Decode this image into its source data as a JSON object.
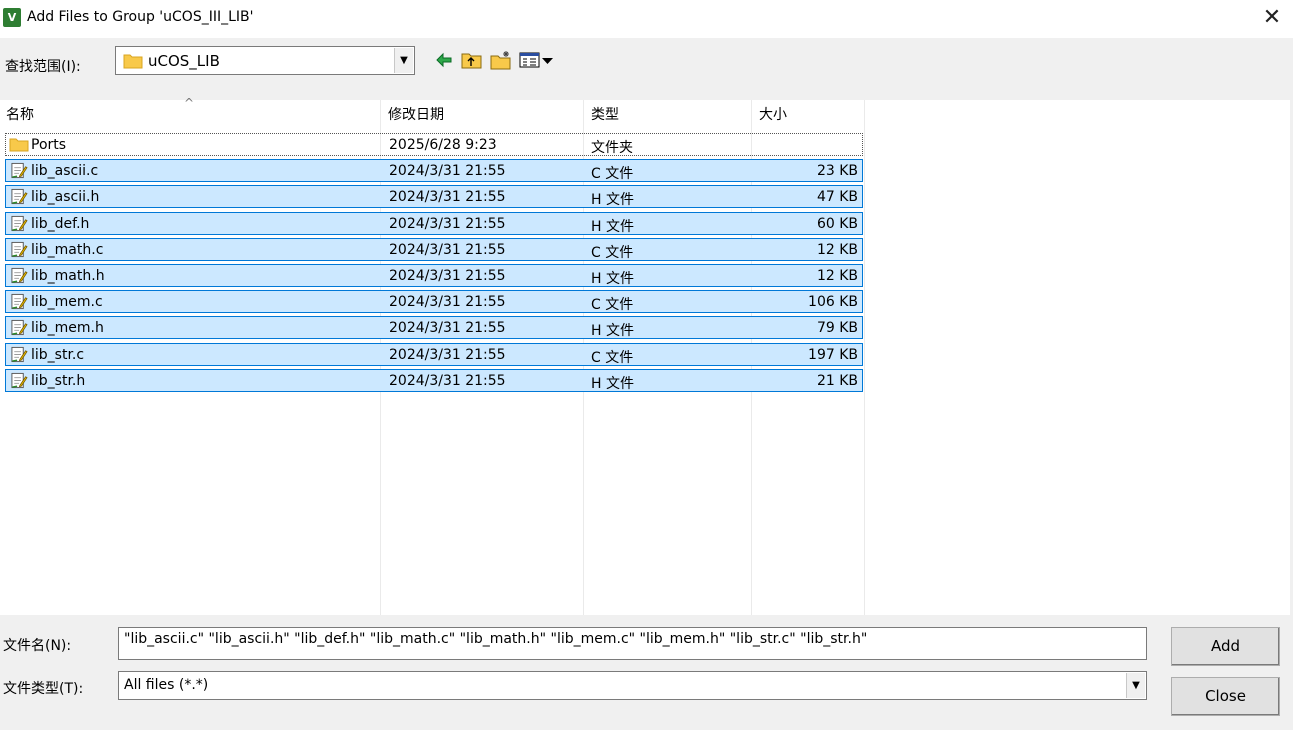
{
  "window": {
    "title": "Add Files to Group 'uCOS_III_LIB'",
    "app_icon_text": "V"
  },
  "lookin": {
    "label": "查找范围(I):",
    "value": "uCOS_LIB"
  },
  "columns": {
    "name": "名称",
    "modified": "修改日期",
    "type": "类型",
    "size": "大小"
  },
  "files": [
    {
      "name": "Ports",
      "modified": "2025/6/28 9:23",
      "type": "文件夹",
      "size": "",
      "kind": "folder",
      "selected": false
    },
    {
      "name": "lib_ascii.c",
      "modified": "2024/3/31 21:55",
      "type": "C 文件",
      "size": "23 KB",
      "kind": "file",
      "selected": true
    },
    {
      "name": "lib_ascii.h",
      "modified": "2024/3/31 21:55",
      "type": "H 文件",
      "size": "47 KB",
      "kind": "file",
      "selected": true
    },
    {
      "name": "lib_def.h",
      "modified": "2024/3/31 21:55",
      "type": "H 文件",
      "size": "60 KB",
      "kind": "file",
      "selected": true
    },
    {
      "name": "lib_math.c",
      "modified": "2024/3/31 21:55",
      "type": "C 文件",
      "size": "12 KB",
      "kind": "file",
      "selected": true
    },
    {
      "name": "lib_math.h",
      "modified": "2024/3/31 21:55",
      "type": "H 文件",
      "size": "12 KB",
      "kind": "file",
      "selected": true
    },
    {
      "name": "lib_mem.c",
      "modified": "2024/3/31 21:55",
      "type": "C 文件",
      "size": "106 KB",
      "kind": "file",
      "selected": true
    },
    {
      "name": "lib_mem.h",
      "modified": "2024/3/31 21:55",
      "type": "H 文件",
      "size": "79 KB",
      "kind": "file",
      "selected": true
    },
    {
      "name": "lib_str.c",
      "modified": "2024/3/31 21:55",
      "type": "C 文件",
      "size": "197 KB",
      "kind": "file",
      "selected": true
    },
    {
      "name": "lib_str.h",
      "modified": "2024/3/31 21:55",
      "type": "H 文件",
      "size": "21 KB",
      "kind": "file",
      "selected": true
    }
  ],
  "filename": {
    "label": "文件名(N):",
    "value": "\"lib_ascii.c\" \"lib_ascii.h\" \"lib_def.h\" \"lib_math.c\" \"lib_math.h\" \"lib_mem.c\" \"lib_mem.h\" \"lib_str.c\" \"lib_str.h\""
  },
  "filetype": {
    "label": "文件类型(T):",
    "value": "All files (*.*)"
  },
  "buttons": {
    "add": "Add",
    "close": "Close"
  },
  "colors": {
    "selection_bg": "#cce8ff",
    "selection_border": "#0078d7",
    "folder": "#f8c94a"
  }
}
